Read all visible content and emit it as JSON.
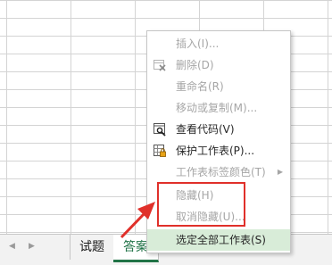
{
  "context_menu": {
    "items": [
      {
        "label": "插入(I)...",
        "enabled": false,
        "icon": ""
      },
      {
        "label": "删除(D)",
        "enabled": false,
        "icon": "delete-sheet-icon"
      },
      {
        "label": "重命名(R)",
        "enabled": false,
        "icon": ""
      },
      {
        "label": "移动或复制(M)...",
        "enabled": false,
        "icon": ""
      },
      {
        "label": "查看代码(V)",
        "enabled": true,
        "icon": "view-code-icon"
      },
      {
        "label": "保护工作表(P)...",
        "enabled": true,
        "icon": "protect-sheet-icon"
      },
      {
        "label": "工作表标签颜色(T)",
        "enabled": false,
        "icon": "",
        "submenu": true
      },
      {
        "label": "隐藏(H)",
        "enabled": false,
        "icon": ""
      },
      {
        "label": "取消隐藏(U)...",
        "enabled": false,
        "icon": ""
      },
      {
        "label": "选定全部工作表(S)",
        "enabled": true,
        "icon": "",
        "selected": true
      }
    ]
  },
  "sheet_tabs": {
    "nav_prev": "◀",
    "nav_next": "▶",
    "tabs": [
      {
        "label": "试题",
        "active": false
      },
      {
        "label": "答案",
        "active": true
      }
    ]
  },
  "colors": {
    "accent_green": "#217346",
    "annotation_red": "#e0302a",
    "selected_item_bg": "#d8ecd8",
    "disabled_text": "#a6a6a6"
  }
}
